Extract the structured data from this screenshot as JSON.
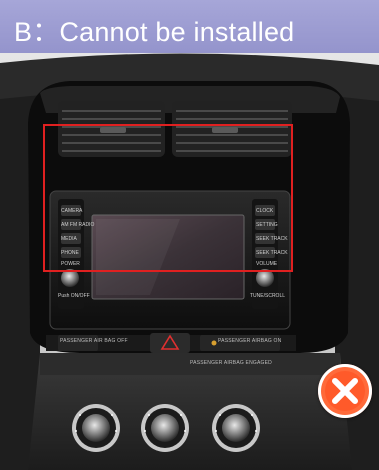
{
  "banner": {
    "title": "B：Cannot be installed"
  },
  "head_unit": {
    "left_buttons": [
      "CAMERA",
      "AM FM RADIO",
      "MEDIA",
      "PHONE",
      "POWER"
    ],
    "right_buttons": [
      "CLOCK",
      "SETTING",
      "SEEK TRACK",
      "SEEK TRACK",
      "VOLUME"
    ],
    "left_knob_label": "Push ON/OFF",
    "right_knob_label": "TUNE/SCROLL"
  },
  "console": {
    "left_switch_text": "PASSENGER AIR BAG OFF",
    "right_switch_text": "PASSENGER AIRBAG ON",
    "lower_caption": "PASSENGER AIRBAG ENGAGED"
  },
  "overlay": {
    "highlight_color": "#e02020",
    "badge_color": "#ff6a3a",
    "badge_icon": "cross-icon"
  }
}
